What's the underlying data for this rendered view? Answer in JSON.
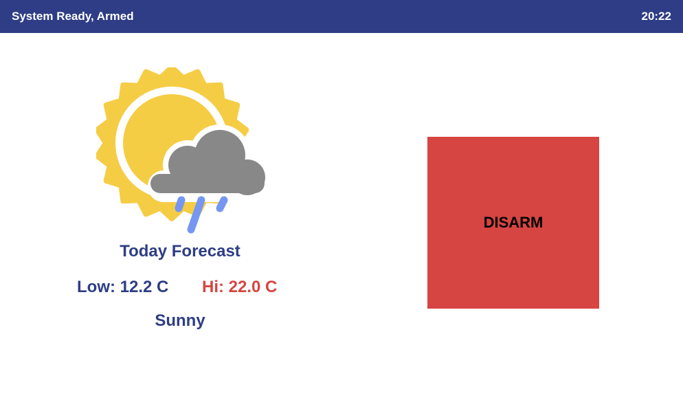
{
  "header": {
    "status": "System Ready, Armed",
    "time": "20:22"
  },
  "weather": {
    "icon": "sun-cloud-rain-icon",
    "title": "Today Forecast",
    "low": "Low: 12.2 C",
    "hi": "Hi: 22.0 C",
    "condition": "Sunny"
  },
  "controls": {
    "disarm_label": "DISARM"
  },
  "colors": {
    "header_bg": "#2e3d85",
    "accent_red": "#d64541",
    "sun": "#f5cd45",
    "cloud": "#888888",
    "rain": "#7597f2"
  }
}
